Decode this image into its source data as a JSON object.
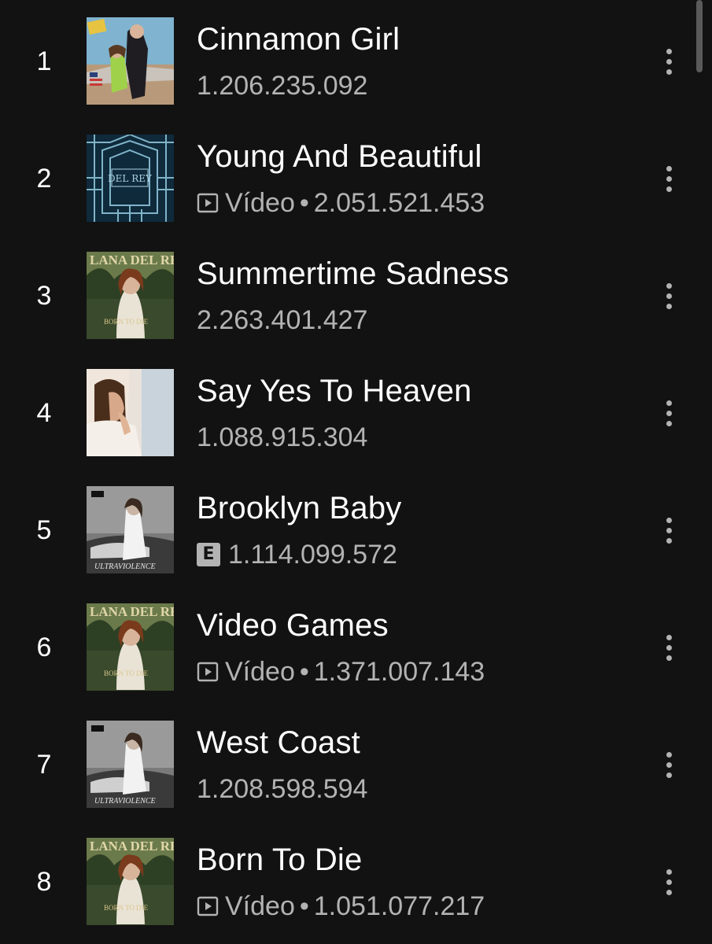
{
  "tracks": [
    {
      "rank": "1",
      "title": "Cinnamon Girl",
      "video_label": "",
      "plays": "1.206.235.092",
      "has_video": false,
      "explicit": false,
      "cover": "cover-nfr"
    },
    {
      "rank": "2",
      "title": "Young And Beautiful",
      "video_label": "Vídeo",
      "plays": "2.051.521.453",
      "has_video": true,
      "explicit": false,
      "cover": "cover-gatsby"
    },
    {
      "rank": "3",
      "title": "Summertime Sadness",
      "video_label": "",
      "plays": "2.263.401.427",
      "has_video": false,
      "explicit": false,
      "cover": "cover-born-to-die"
    },
    {
      "rank": "4",
      "title": "Say Yes To Heaven",
      "video_label": "",
      "plays": "1.088.915.304",
      "has_video": false,
      "explicit": false,
      "cover": "cover-say-yes"
    },
    {
      "rank": "5",
      "title": "Brooklyn Baby",
      "video_label": "",
      "plays": "1.114.099.572",
      "has_video": false,
      "explicit": true,
      "explicit_label": "E",
      "cover": "cover-ultraviolence"
    },
    {
      "rank": "6",
      "title": "Video Games",
      "video_label": "Vídeo",
      "plays": "1.371.007.143",
      "has_video": true,
      "explicit": false,
      "cover": "cover-born-to-die"
    },
    {
      "rank": "7",
      "title": "West Coast",
      "video_label": "",
      "plays": "1.208.598.594",
      "has_video": false,
      "explicit": false,
      "cover": "cover-ultraviolence"
    },
    {
      "rank": "8",
      "title": "Born To Die",
      "video_label": "Vídeo",
      "plays": "1.051.077.217",
      "has_video": true,
      "explicit": false,
      "cover": "cover-born-to-die"
    }
  ],
  "separator": "•",
  "icons": {
    "video": "video-icon",
    "explicit": "explicit-badge",
    "more": "more-options-icon"
  },
  "colors": {
    "background": "#121212",
    "primary_text": "#ffffff",
    "secondary_text": "#b3b3b3"
  }
}
